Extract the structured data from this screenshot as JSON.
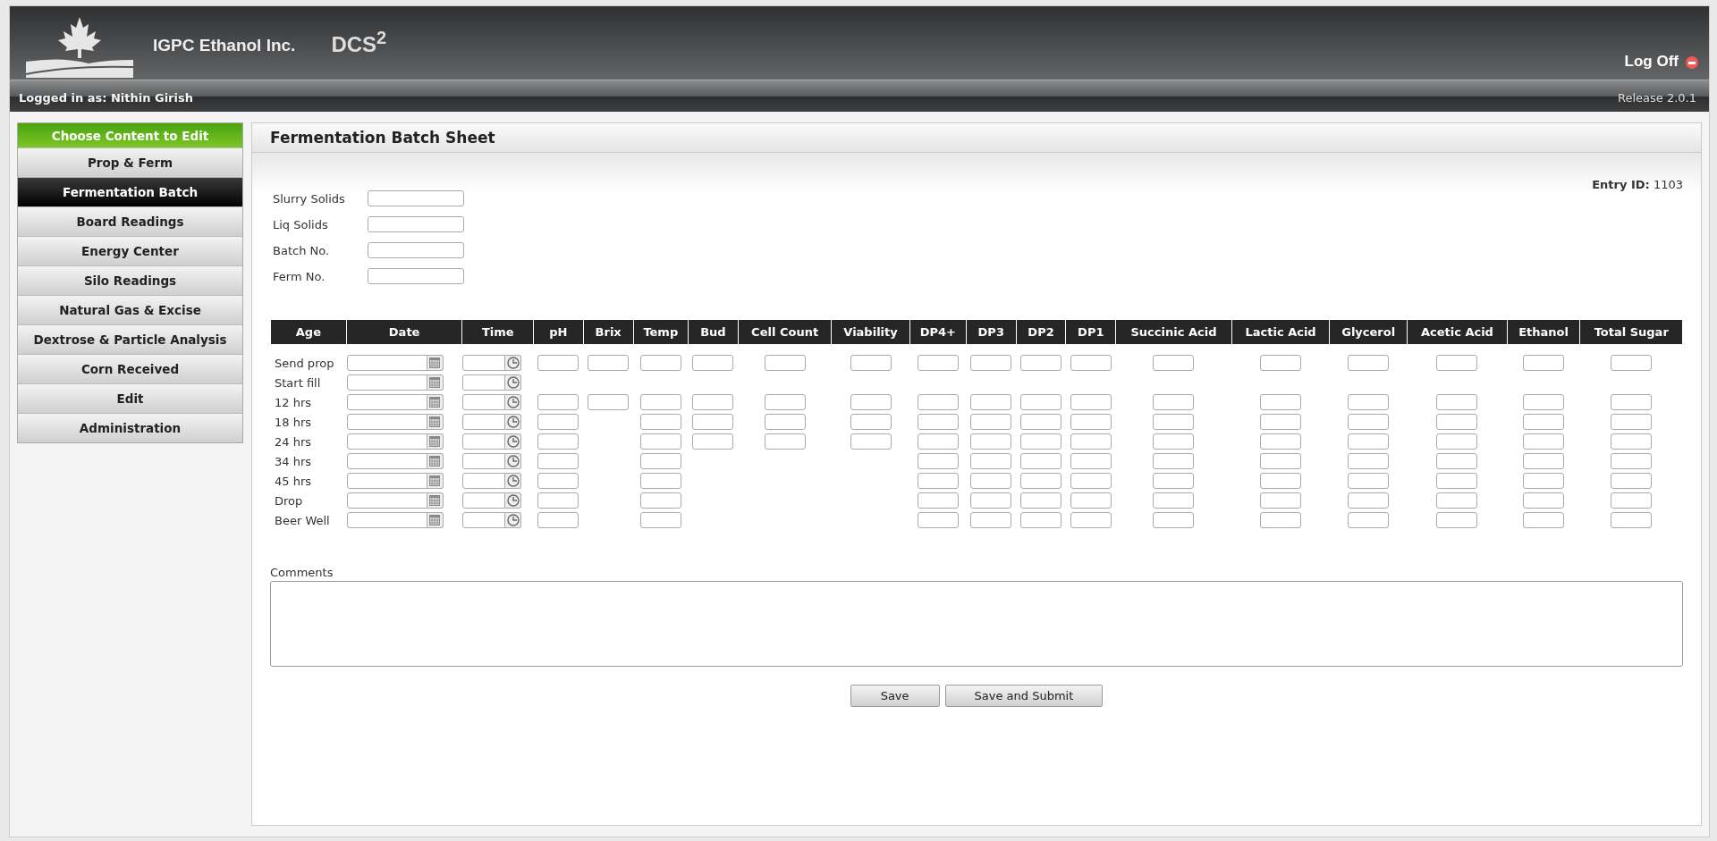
{
  "header": {
    "company": "IGPC Ethanol Inc.",
    "product": "DCS$^{2}$",
    "log_off": "Log Off"
  },
  "user_bar": {
    "logged_in": "Logged in as: Nithin Girish",
    "release": "Release 2.0.1"
  },
  "sidebar": {
    "title": "Choose Content to Edit",
    "items": [
      {
        "label": "Prop & Ferm",
        "selected": false
      },
      {
        "label": "Fermentation Batch",
        "selected": true
      },
      {
        "label": "Board Readings",
        "selected": false
      },
      {
        "label": "Energy Center",
        "selected": false
      },
      {
        "label": "Silo Readings",
        "selected": false
      },
      {
        "label": "Natural Gas & Excise",
        "selected": false
      },
      {
        "label": "Dextrose & Particle Analysis",
        "selected": false
      },
      {
        "label": "Corn Received",
        "selected": false
      },
      {
        "label": "Edit",
        "selected": false
      },
      {
        "label": "Administration",
        "selected": false
      }
    ]
  },
  "panel": {
    "title": "Fermentation Batch Sheet",
    "entry_label": "Entry ID:",
    "entry_id": "1103",
    "fields": [
      "Slurry Solids",
      "Liq Solids",
      "Batch No.",
      "Ferm No."
    ],
    "table": {
      "columns": [
        "Age",
        "Date",
        "Time",
        "pH",
        "Brix",
        "Temp",
        "Bud",
        "Cell Count",
        "Viability",
        "DP4+",
        "DP3",
        "DP2",
        "DP1",
        "Succinic Acid",
        "Lactic Acid",
        "Glycerol",
        "Acetic Acid",
        "Ethanol",
        "Total Sugar"
      ],
      "rows": [
        {
          "age": "Send prop",
          "inputs": [
            true,
            true,
            true,
            true,
            true,
            true,
            true,
            true,
            true,
            true,
            true,
            true,
            true,
            true,
            true,
            true
          ]
        },
        {
          "age": "Start fill",
          "inputs": [
            false,
            false,
            false,
            false,
            false,
            false,
            false,
            false,
            false,
            false,
            false,
            false,
            false,
            false,
            false,
            false
          ]
        },
        {
          "age": "12 hrs",
          "inputs": [
            true,
            true,
            true,
            true,
            true,
            true,
            true,
            true,
            true,
            true,
            true,
            true,
            true,
            true,
            true,
            true
          ]
        },
        {
          "age": "18 hrs",
          "inputs": [
            true,
            false,
            true,
            true,
            true,
            true,
            true,
            true,
            true,
            true,
            true,
            true,
            true,
            true,
            true,
            true
          ]
        },
        {
          "age": "24 hrs",
          "inputs": [
            true,
            false,
            true,
            true,
            true,
            true,
            true,
            true,
            true,
            true,
            true,
            true,
            true,
            true,
            true,
            true
          ]
        },
        {
          "age": "34 hrs",
          "inputs": [
            true,
            false,
            true,
            false,
            false,
            false,
            true,
            true,
            true,
            true,
            true,
            true,
            true,
            true,
            true,
            true
          ]
        },
        {
          "age": "45 hrs",
          "inputs": [
            true,
            false,
            true,
            false,
            false,
            false,
            true,
            true,
            true,
            true,
            true,
            true,
            true,
            true,
            true,
            true
          ]
        },
        {
          "age": "Drop",
          "inputs": [
            true,
            false,
            true,
            false,
            false,
            false,
            true,
            true,
            true,
            true,
            true,
            true,
            true,
            true,
            true,
            true
          ]
        },
        {
          "age": "Beer Well",
          "inputs": [
            true,
            false,
            true,
            false,
            false,
            false,
            true,
            true,
            true,
            true,
            true,
            true,
            true,
            true,
            true,
            true
          ]
        }
      ]
    },
    "comments_label": "Comments",
    "buttons": [
      "Save",
      "Save and Submit"
    ]
  }
}
